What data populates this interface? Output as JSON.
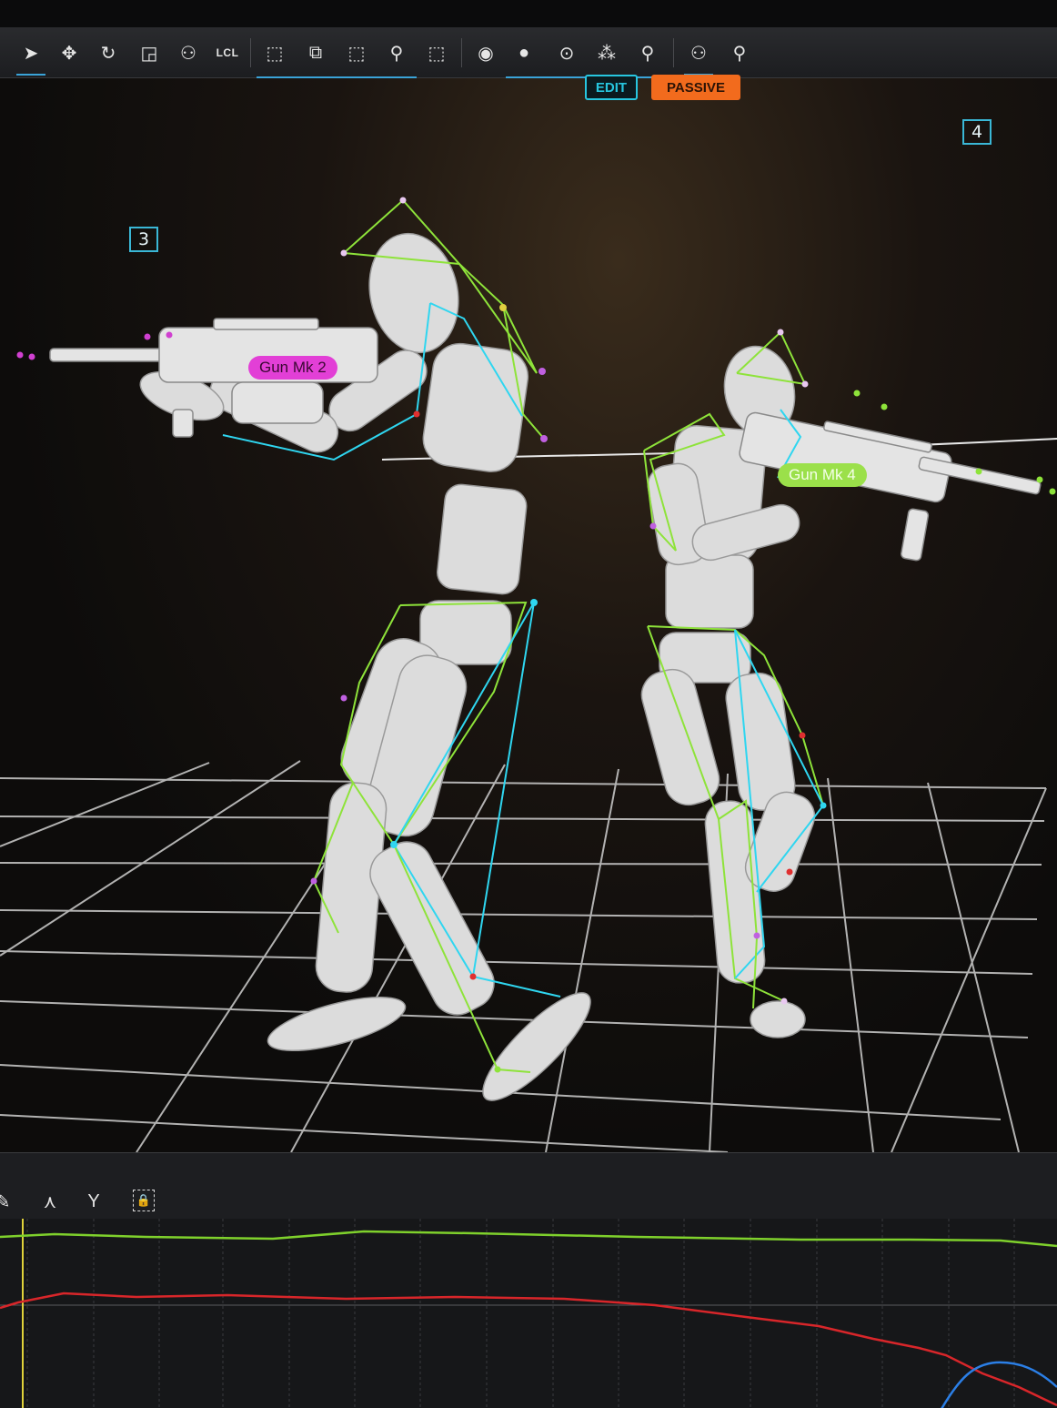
{
  "toolbar": {
    "tools": [
      {
        "name": "select-tool",
        "glyph": "➤"
      },
      {
        "name": "move-tool",
        "glyph": "✥"
      },
      {
        "name": "rotate-tool",
        "glyph": "↻"
      },
      {
        "name": "scale-tool",
        "glyph": "◲"
      },
      {
        "name": "pose-tool",
        "glyph": "⚇"
      },
      {
        "name": "local-space-toggle",
        "glyph": "LCL"
      },
      {
        "name": "select-markers-tool",
        "glyph": "⬚"
      },
      {
        "name": "select-rigid-tool",
        "glyph": "⧉"
      },
      {
        "name": "select-bones-tool",
        "glyph": "⬚"
      },
      {
        "name": "select-skeleton-tool",
        "glyph": "⚲"
      },
      {
        "name": "select-all-tool",
        "glyph": "⬚"
      },
      {
        "name": "visibility-toggle",
        "glyph": "◉"
      },
      {
        "name": "show-markers-toggle",
        "glyph": "●"
      },
      {
        "name": "show-rigid-bodies-toggle",
        "glyph": "⊙"
      },
      {
        "name": "show-constellation-toggle",
        "glyph": "⁂"
      },
      {
        "name": "show-skeleton-toggle",
        "glyph": "⚲"
      },
      {
        "name": "show-pair-toggle",
        "glyph": "⚇"
      },
      {
        "name": "show-actor-toggle",
        "glyph": "⚲"
      }
    ]
  },
  "modes": {
    "edit_label": "EDIT",
    "passive_label": "PASSIVE"
  },
  "viewport": {
    "camera_tags": [
      {
        "label": "3"
      },
      {
        "label": "4"
      }
    ],
    "rigid_bodies": [
      {
        "label": "Gun Mk 2",
        "color": "#e23fd6"
      },
      {
        "label": "Gun Mk 4",
        "color": "#9be04a"
      }
    ],
    "colors": {
      "marker_line_green": "#8ee33a",
      "marker_line_cyan": "#2fd6f0",
      "grid": "#d8d8d8",
      "body": "#dcdcdc"
    }
  },
  "graph": {
    "tools": [
      {
        "name": "pencil-tool",
        "glyph": "✎"
      },
      {
        "name": "fit-up-icon",
        "glyph": "⋏"
      },
      {
        "name": "fit-down-icon",
        "glyph": "Y"
      },
      {
        "name": "lock-icon",
        "glyph": "🔒"
      }
    ],
    "series_colors": {
      "green": "#7fd12c",
      "red": "#d8262a",
      "blue": "#2b7fe6",
      "cursor": "#e0d23a"
    }
  }
}
